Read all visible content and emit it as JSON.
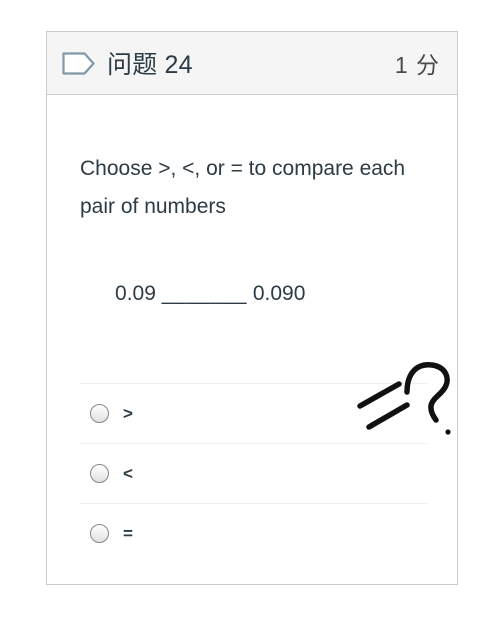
{
  "card": {
    "header": {
      "flag_icon": "flag-tag-icon",
      "question_label": "问题 24",
      "points_label": "1 分",
      "background_color": "#f5f5f5",
      "border_color": "#c7cdd1"
    },
    "body": {
      "prompt": "Choose >, <, or = to compare each pair of numbers",
      "equation": {
        "left_number": "0.09",
        "blank": "_______",
        "right_number": "0.090",
        "full_text": "0.09 _______ 0.090"
      },
      "answers": [
        {
          "value": ">",
          "selected": false
        },
        {
          "value": "<",
          "selected": false
        },
        {
          "value": "=",
          "selected": false
        }
      ],
      "annotation": {
        "description": "handwritten question mark and approximately-equal strokes",
        "color": "#111111"
      },
      "text_color": "#2d3b45",
      "divider_color": "#eceef0"
    }
  }
}
